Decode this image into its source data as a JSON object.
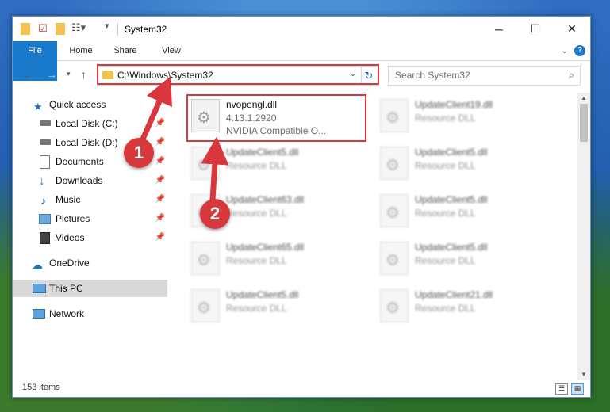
{
  "window": {
    "title": "System32",
    "minimize_glyph": "─",
    "maximize_glyph": "☐",
    "close_glyph": "✕"
  },
  "ribbon": {
    "tabs": [
      "File",
      "Home",
      "Share",
      "View"
    ],
    "help_glyph": "?"
  },
  "address": {
    "path": "C:\\Windows\\System32",
    "search_placeholder": "Search System32"
  },
  "nav_pane": [
    {
      "label": "Quick access",
      "icon": "star-icon",
      "pinned": false
    },
    {
      "label": "Local Disk (C:)",
      "icon": "drive-icon",
      "pinned": true
    },
    {
      "label": "Local Disk (D:)",
      "icon": "drive-icon",
      "pinned": true
    },
    {
      "label": "Documents",
      "icon": "documents-icon",
      "pinned": true
    },
    {
      "label": "Downloads",
      "icon": "download-icon",
      "pinned": true
    },
    {
      "label": "Music",
      "icon": "music-icon",
      "pinned": true
    },
    {
      "label": "Pictures",
      "icon": "pictures-icon",
      "pinned": true
    },
    {
      "label": "Videos",
      "icon": "videos-icon",
      "pinned": true
    },
    {
      "label": "OneDrive",
      "icon": "cloud-icon",
      "pinned": false
    },
    {
      "label": "This PC",
      "icon": "computer-icon",
      "pinned": false,
      "selected": true
    },
    {
      "label": "Network",
      "icon": "network-icon",
      "pinned": false
    }
  ],
  "files": [
    {
      "name": "nvopengl.dll",
      "line2": "4.13.1.2920",
      "line3": "NVIDIA Compatible O..."
    },
    {
      "name": "UpdateClient19.dll",
      "line2": "Resource DLL"
    },
    {
      "name": "UpdateClient5.dll",
      "line2": "Resource DLL"
    },
    {
      "name": "UpdateClient5.dll",
      "line2": "Resource DLL"
    },
    {
      "name": "UpdateClient63.dll",
      "line2": "Resource DLL"
    },
    {
      "name": "UpdateClient5.dll",
      "line2": "Resource DLL"
    },
    {
      "name": "UpdateClient65.dll",
      "line2": "Resource DLL"
    },
    {
      "name": "UpdateClient5.dll",
      "line2": "Resource DLL"
    },
    {
      "name": "UpdateClient5.dll",
      "line2": "Resource DLL"
    },
    {
      "name": "UpdateClient21.dll",
      "line2": "Resource DLL"
    }
  ],
  "status": {
    "item_count": "153 items"
  },
  "callouts": [
    "1",
    "2"
  ],
  "colors": {
    "accent": "#1979ca",
    "highlight": "#d8373b",
    "selection": "#d9d9d9"
  }
}
